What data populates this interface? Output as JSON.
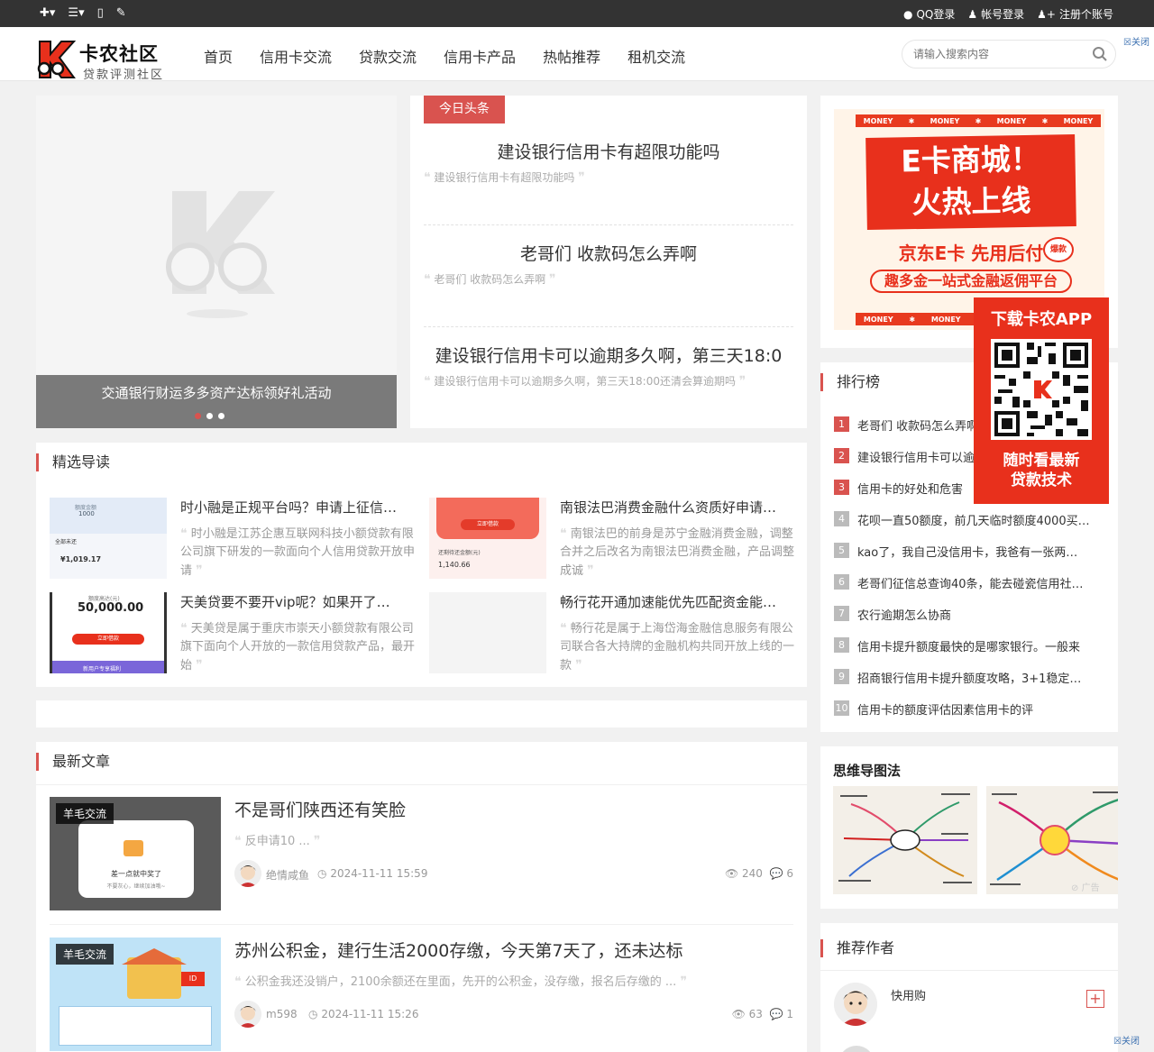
{
  "topbar": {
    "left_icons": [
      "plus-icon",
      "menu-icon",
      "mobile-icon",
      "edit-icon"
    ],
    "qq_login": "QQ登录",
    "account_login": "帐号登录",
    "register": "注册个账号"
  },
  "header": {
    "logo_title": "卡农社区",
    "logo_subtitle": "贷款评测社区",
    "nav": [
      "首页",
      "信用卡交流",
      "贷款交流",
      "信用卡产品",
      "热帖推荐",
      "租机交流"
    ],
    "search_placeholder": "请输入搜索内容",
    "close_label": "关闭"
  },
  "slider": {
    "caption": "交通银行财运多多资产达标领好礼活动",
    "dots": 3,
    "active_dot": 1
  },
  "headlines": {
    "tag": "今日头条",
    "items": [
      {
        "title": "建设银行信用卡有超限功能吗",
        "desc": "建设银行信用卡有超限功能吗"
      },
      {
        "title": "老哥们 收款码怎么弄啊",
        "desc": "老哥们 收款码怎么弄啊"
      },
      {
        "title": "建设银行信用卡可以逾期多久啊，第三天18:0",
        "desc": "建设银行信用卡可以逾期多久啊，第三天18:00还清会算逾期吗"
      }
    ]
  },
  "ad_poster": {
    "ribbon": [
      "MONEY",
      "MONEY",
      "MONEY",
      "MONEY"
    ],
    "headline1": "E卡商城！",
    "headline2": "火热上线",
    "line1": "京东E卡 先用后付",
    "line2": "趣多金一站式金融返佣平台",
    "badge": "爆款"
  },
  "app_download": {
    "title": "下载卡农APP",
    "line1": "随时看最新",
    "line2": "贷款技术"
  },
  "ranking": {
    "title": "排行榜",
    "items": [
      "老哥们 收款码怎么弄啊",
      "建设银行信用卡可以逾期多久啊",
      "信用卡的好处和危害",
      "花呗一直50额度，前几天临时额度4000买…",
      "kao了，我自己没信用卡，我爸有一张两…",
      "老哥们征信总查询40条，能去碰瓷信用社…",
      "农行逾期怎么协商",
      "信用卡提升额度最快的是哪家银行。一般来",
      "招商银行信用卡提升额度攻略，3+1稳定…",
      "信用卡的额度评估因素信用卡的评"
    ]
  },
  "featured": {
    "title": "精选导读",
    "items": [
      {
        "title": "时小融是正规平台吗？申请上征信…",
        "desc": "时小融是江苏企惠互联网科技小额贷款有限公司旗下研发的一款面向个人信用贷款开放申请",
        "thumb_text": [
          "额度金额",
          "1000",
          "全部未还",
          "¥1,019.17"
        ]
      },
      {
        "title": "南银法巴消费金融什么资质好申请…",
        "desc": "南银法巴的前身是苏宁金融消费金融，调整合并之后改名为南银法巴消费金融，产品调整成诚",
        "thumb_text": [
          "立即借款",
          "还剩待还金额(元)",
          "1,140.66"
        ]
      },
      {
        "title": "天美贷要不要开vip呢？如果开了…",
        "desc": "天美贷是属于重庆市崇天小额贷款有限公司旗下面向个人开放的一款信用贷款产品，最开始",
        "thumb_text": [
          "额度高达(元)",
          "50,000.00",
          "立即借款",
          "新用户专享福利"
        ]
      },
      {
        "title": "畅行花开通加速能优先匹配资金能…",
        "desc": "畅行花是属于上海岱海金融信息服务有限公司联合各大持牌的金融机构共同开放上线的一款",
        "thumb_text": []
      }
    ]
  },
  "latest": {
    "title": "最新文章",
    "articles": [
      {
        "tag": "羊毛交流",
        "title": "不是哥们陕西还有笑脸",
        "excerpt": "反申请10 ...",
        "author": "绝情咸鱼",
        "date": "2024-11-11 15:59",
        "views": "240",
        "comments": "6",
        "thumb_text": [
          "差一点就中奖了",
          "不要灰心，继续加油哦~"
        ]
      },
      {
        "tag": "羊毛交流",
        "title": "苏州公积金，建行生活2000存缴，今天第7天了，还未达标",
        "excerpt": "公积金我还没销户，2100余额还在里面，先开的公积金，没存缴，报名后存缴的 ...",
        "author": "m598",
        "date": "2024-11-11 15:26",
        "views": "63",
        "comments": "1",
        "thumb_text": [
          "ID"
        ]
      }
    ]
  },
  "mindmap": {
    "title": "思维导图法",
    "ad_label": "广告"
  },
  "authors": {
    "title": "推荐作者",
    "items": [
      {
        "name": "快用购"
      }
    ]
  },
  "colors": {
    "accent": "#d9534f",
    "topbar": "#333333",
    "poster_red": "#e8301c"
  }
}
